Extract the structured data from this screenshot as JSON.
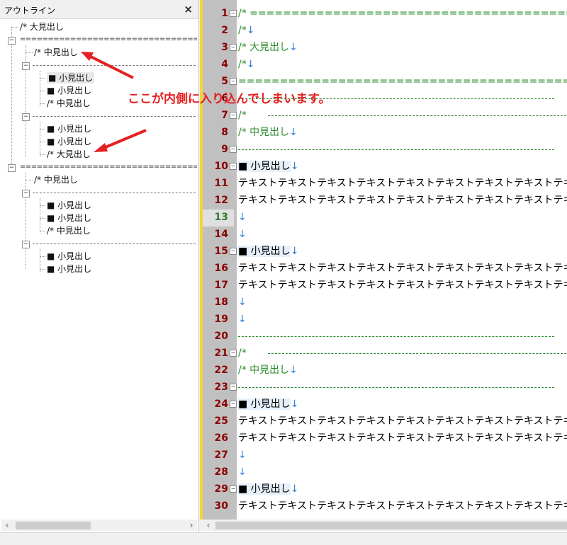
{
  "outline": {
    "title": "アウトライン",
    "close": "×",
    "items": [
      {
        "label": "/* 大見出し"
      },
      {
        "label": "=================================="
      },
      {
        "label": "/* 中見出し"
      },
      {
        "label": "-----------------------------------------------"
      },
      {
        "label": "■ 小見出し"
      },
      {
        "label": "■ 小見出し"
      },
      {
        "label": "/* 中見出し"
      },
      {
        "label": "-----------------------------------------------"
      },
      {
        "label": "■ 小見出し"
      },
      {
        "label": "■ 小見出し"
      },
      {
        "label": "/* 大見出し"
      },
      {
        "label": "=================================="
      },
      {
        "label": "/* 中見出し"
      },
      {
        "label": "-----------------------------------------------"
      },
      {
        "label": "■ 小見出し"
      },
      {
        "label": "■ 小見出し"
      },
      {
        "label": "/* 中見出し"
      },
      {
        "label": "-----------------------------------------------"
      },
      {
        "label": "■ 小見出し"
      },
      {
        "label": "■ 小見出し"
      }
    ]
  },
  "annotation": {
    "text": "ここが内側に入り込んでしまいます。",
    "color": "#e52020"
  },
  "editor": {
    "return_mark": "↓",
    "text_line": "テキストテキストテキストテキストテキストテキストテキストテキストテキスト",
    "lines": [
      {
        "n": "1",
        "text": "/* ======================================================"
      },
      {
        "n": "2",
        "text": "/*"
      },
      {
        "n": "3",
        "text": "/* 大見出し"
      },
      {
        "n": "4",
        "text": "/*"
      },
      {
        "n": "5",
        "text": "=========================================================="
      },
      {
        "n": "6",
        "text": ""
      },
      {
        "n": "7",
        "text": "/* "
      },
      {
        "n": "8",
        "text": "/* 中見出し"
      },
      {
        "n": "9",
        "text": ""
      },
      {
        "n": "10",
        "text": "■ 小見出し"
      },
      {
        "n": "11",
        "text": ""
      },
      {
        "n": "12",
        "text": ""
      },
      {
        "n": "13",
        "text": ""
      },
      {
        "n": "14",
        "text": ""
      },
      {
        "n": "15",
        "text": "■ 小見出し"
      },
      {
        "n": "16",
        "text": ""
      },
      {
        "n": "17",
        "text": ""
      },
      {
        "n": "18",
        "text": ""
      },
      {
        "n": "19",
        "text": ""
      },
      {
        "n": "20",
        "text": ""
      },
      {
        "n": "21",
        "text": "/* "
      },
      {
        "n": "22",
        "text": "/* 中見出し"
      },
      {
        "n": "23",
        "text": ""
      },
      {
        "n": "24",
        "text": "■ 小見出し"
      },
      {
        "n": "25",
        "text": ""
      },
      {
        "n": "26",
        "text": ""
      },
      {
        "n": "27",
        "text": ""
      },
      {
        "n": "28",
        "text": ""
      },
      {
        "n": "29",
        "text": "■ 小見出し"
      },
      {
        "n": "30",
        "text": ""
      }
    ],
    "current_line": "13"
  },
  "colors": {
    "line_number": "#8b0000",
    "current_line_number": "#2e7d32",
    "comment": "#2a8a2a",
    "return_mark": "#2e7fd6",
    "gutter_marker": "#f6d531"
  },
  "icons": [
    "close-icon",
    "expand-box-icon",
    "scroll-left-icon",
    "scroll-right-icon",
    "arrow-annotation"
  ]
}
